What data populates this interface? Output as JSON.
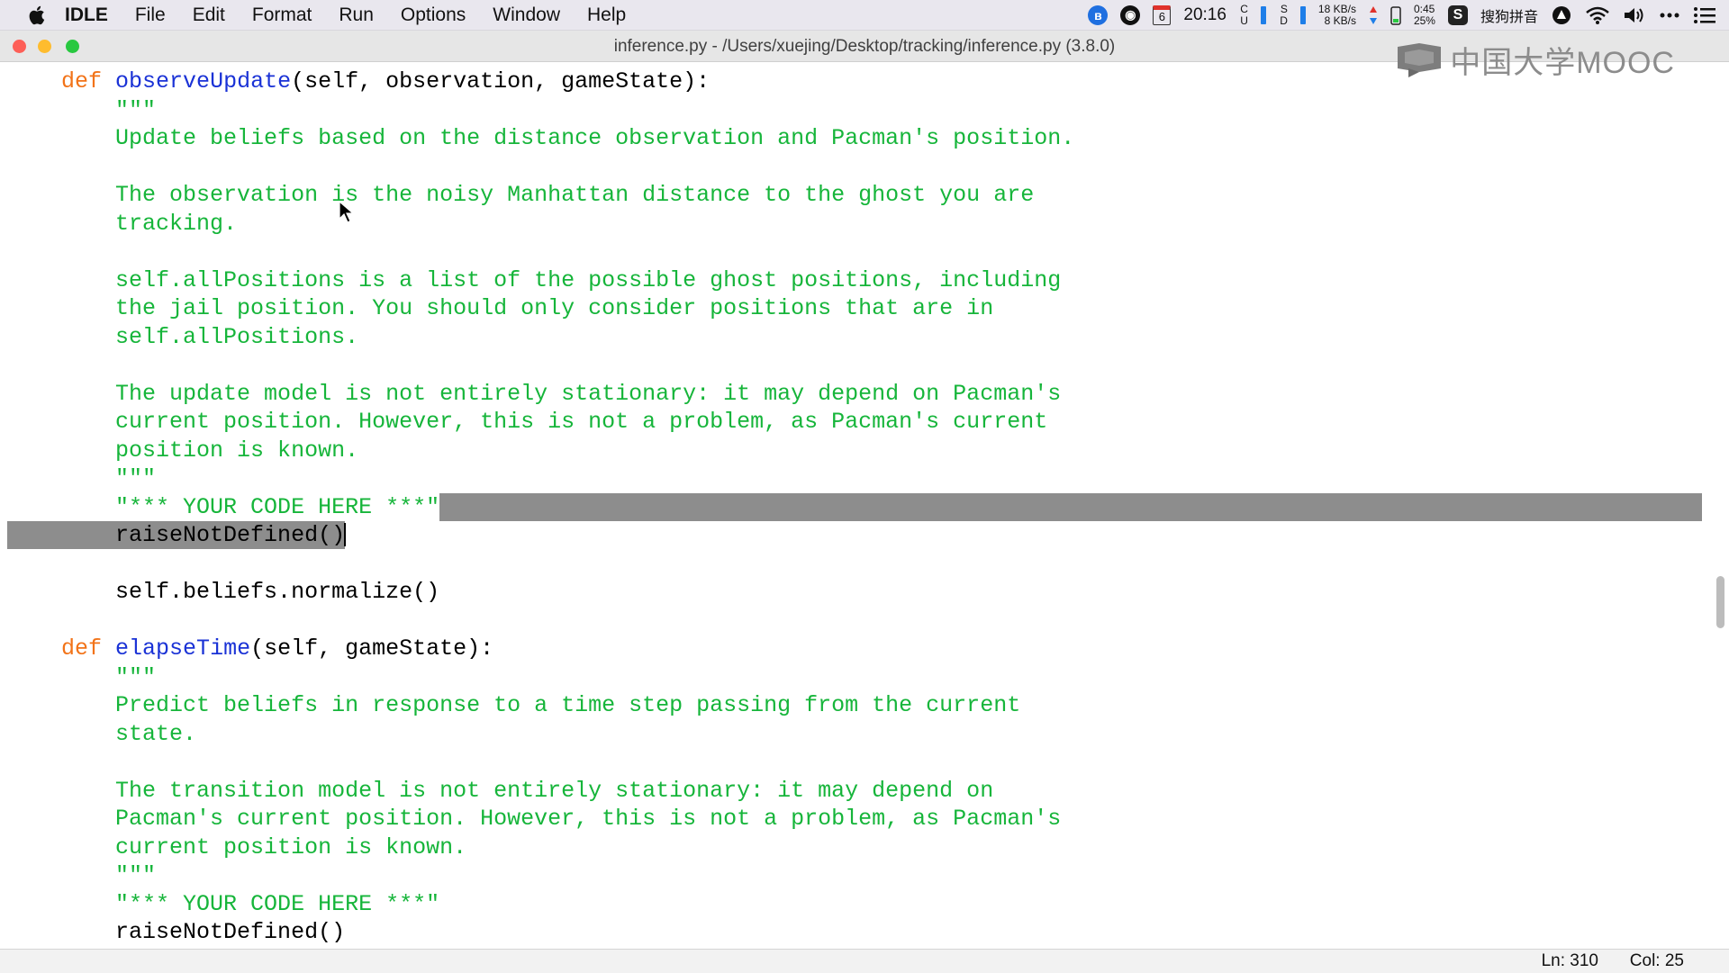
{
  "menubar": {
    "items": [
      "IDLE",
      "File",
      "Edit",
      "Format",
      "Run",
      "Options",
      "Window",
      "Help"
    ],
    "calendar_day": "6",
    "time": "20:16",
    "cpu_label": "C U",
    "ssd_label": "S D",
    "net_up": "18 KB/s",
    "net_down": "8 KB/s",
    "battery_time": "0:45",
    "battery_pct": "25%",
    "ime": "搜狗拼音"
  },
  "window": {
    "title": "inference.py - /Users/xuejing/Desktop/tracking/inference.py (3.8.0)"
  },
  "watermark": {
    "text": "中国大学MOOC"
  },
  "code": {
    "lines": [
      {
        "segs": [
          {
            "t": "    "
          },
          {
            "t": "def",
            "c": "kw"
          },
          {
            "t": " "
          },
          {
            "t": "observeUpdate",
            "c": "fn"
          },
          {
            "t": "(self, observation, gameState):"
          }
        ]
      },
      {
        "segs": [
          {
            "t": "        "
          },
          {
            "t": "\"\"\"",
            "c": "str"
          }
        ]
      },
      {
        "segs": [
          {
            "t": "        "
          },
          {
            "t": "Update beliefs based on the distance observation and Pacman's position.",
            "c": "str"
          }
        ]
      },
      {
        "segs": []
      },
      {
        "segs": [
          {
            "t": "        "
          },
          {
            "t": "The observation is the noisy Manhattan distance to the ghost you are",
            "c": "str"
          }
        ]
      },
      {
        "segs": [
          {
            "t": "        "
          },
          {
            "t": "tracking.",
            "c": "str"
          }
        ]
      },
      {
        "segs": []
      },
      {
        "segs": [
          {
            "t": "        "
          },
          {
            "t": "self.allPositions is a list of the possible ghost positions, including",
            "c": "str"
          }
        ]
      },
      {
        "segs": [
          {
            "t": "        "
          },
          {
            "t": "the jail position. You should only consider positions that are in",
            "c": "str"
          }
        ]
      },
      {
        "segs": [
          {
            "t": "        "
          },
          {
            "t": "self.allPositions.",
            "c": "str"
          }
        ]
      },
      {
        "segs": []
      },
      {
        "segs": [
          {
            "t": "        "
          },
          {
            "t": "The update model is not entirely stationary: it may depend on Pacman's",
            "c": "str"
          }
        ]
      },
      {
        "segs": [
          {
            "t": "        "
          },
          {
            "t": "current position. However, this is not a problem, as Pacman's current",
            "c": "str"
          }
        ]
      },
      {
        "segs": [
          {
            "t": "        "
          },
          {
            "t": "position is known.",
            "c": "str"
          }
        ]
      },
      {
        "segs": [
          {
            "t": "        "
          },
          {
            "t": "\"\"\"",
            "c": "str"
          }
        ]
      },
      {
        "segs": [
          {
            "t": "        "
          },
          {
            "t": "\"*** YOUR CODE HERE ***\"",
            "c": "str"
          }
        ],
        "sel": "after"
      },
      {
        "segs": [
          {
            "t": "        "
          },
          {
            "t": "raiseNotDefined()"
          }
        ],
        "sel": "before",
        "caret": true
      },
      {
        "segs": []
      },
      {
        "segs": [
          {
            "t": "        "
          },
          {
            "t": "self.beliefs.normalize()"
          }
        ]
      },
      {
        "segs": []
      },
      {
        "segs": [
          {
            "t": "    "
          },
          {
            "t": "def",
            "c": "kw"
          },
          {
            "t": " "
          },
          {
            "t": "elapseTime",
            "c": "fn"
          },
          {
            "t": "(self, gameState):"
          }
        ]
      },
      {
        "segs": [
          {
            "t": "        "
          },
          {
            "t": "\"\"\"",
            "c": "str"
          }
        ]
      },
      {
        "segs": [
          {
            "t": "        "
          },
          {
            "t": "Predict beliefs in response to a time step passing from the current",
            "c": "str"
          }
        ]
      },
      {
        "segs": [
          {
            "t": "        "
          },
          {
            "t": "state.",
            "c": "str"
          }
        ]
      },
      {
        "segs": []
      },
      {
        "segs": [
          {
            "t": "        "
          },
          {
            "t": "The transition model is not entirely stationary: it may depend on",
            "c": "str"
          }
        ]
      },
      {
        "segs": [
          {
            "t": "        "
          },
          {
            "t": "Pacman's current position. However, this is not a problem, as Pacman's",
            "c": "str"
          }
        ]
      },
      {
        "segs": [
          {
            "t": "        "
          },
          {
            "t": "current position is known.",
            "c": "str"
          }
        ]
      },
      {
        "segs": [
          {
            "t": "        "
          },
          {
            "t": "\"\"\"",
            "c": "str"
          }
        ]
      },
      {
        "segs": [
          {
            "t": "        "
          },
          {
            "t": "\"*** YOUR CODE HERE ***\"",
            "c": "str"
          }
        ]
      },
      {
        "segs": [
          {
            "t": "        "
          },
          {
            "t": "raiseNotDefined()"
          }
        ]
      }
    ]
  },
  "status": {
    "ln": "Ln: 310",
    "col": "Col: 25"
  },
  "colors": {
    "keyword": "#f27318",
    "function": "#1a32d6",
    "string": "#16b53a",
    "selection": "#8d8d8d"
  }
}
